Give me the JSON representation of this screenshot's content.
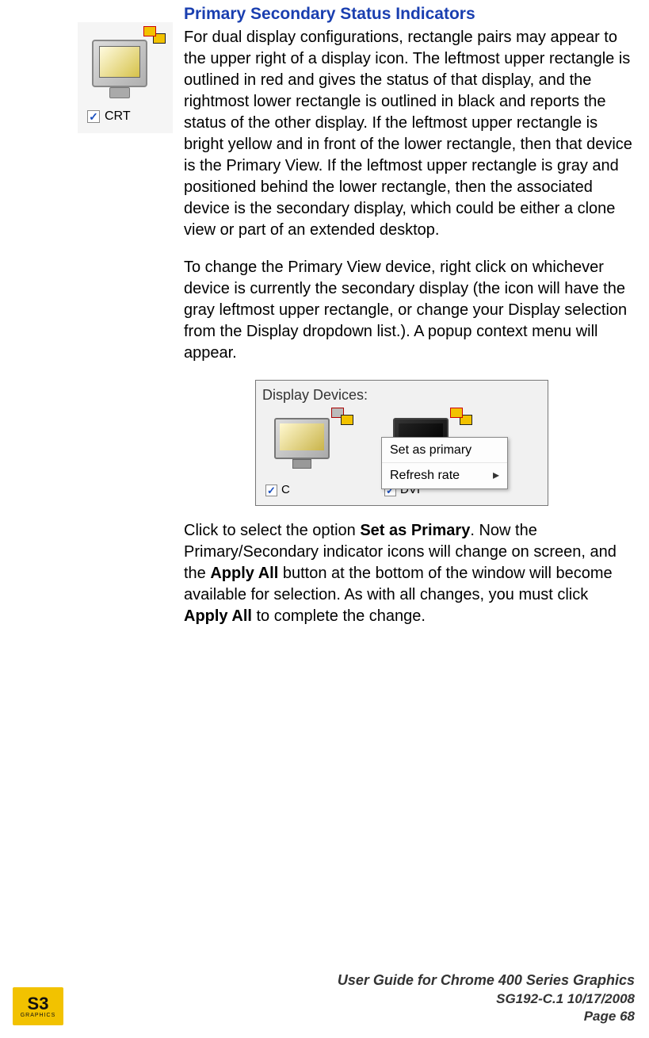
{
  "section": {
    "title": "Primary Secondary Status Indicators",
    "crt_label": "CRT",
    "para1": "For dual display configurations, rectangle pairs may appear to the upper right of a display icon. The leftmost upper rectangle is outlined in red and gives the status of that display, and the rightmost lower rectangle is outlined in black and reports the status of the other display. If the leftmost upper rectangle is bright yellow and in front of the lower rectangle, then that device is the Primary View. If the leftmost upper rectangle is gray and positioned behind the lower rectangle, then the associated device is the secondary display, which could be either a clone view or part of an extended desktop.",
    "para2": "To change the Primary View device, right click on whichever device is currently the secondary display (the icon will have the gray leftmost upper rectangle, or change your Display selection from the Display dropdown list.). A popup context menu will appear."
  },
  "figure2": {
    "caption": "Display Devices:",
    "dev1_label": "C",
    "dev2_label": "DVI",
    "menu": {
      "item1": "Set as primary",
      "item2": "Refresh rate",
      "arrow": "▸"
    }
  },
  "para3": {
    "t1": "Click to select the option ",
    "b1": "Set as Primary",
    "t2": ". Now the Primary/Secondary indicator icons will change on screen, and the ",
    "b2": "Apply All",
    "t3": " button at the bottom of the window will become available for selection. As with all changes, you must click ",
    "b3": "Apply All",
    "t4": " to complete the change."
  },
  "footer": {
    "line1": "User Guide for Chrome 400 Series Graphics",
    "line2": "SG192-C.1   10/17/2008",
    "line3_label": "Page ",
    "line3_num": "68"
  },
  "logo": {
    "text": "S3",
    "sub": "GRAPHICS"
  }
}
